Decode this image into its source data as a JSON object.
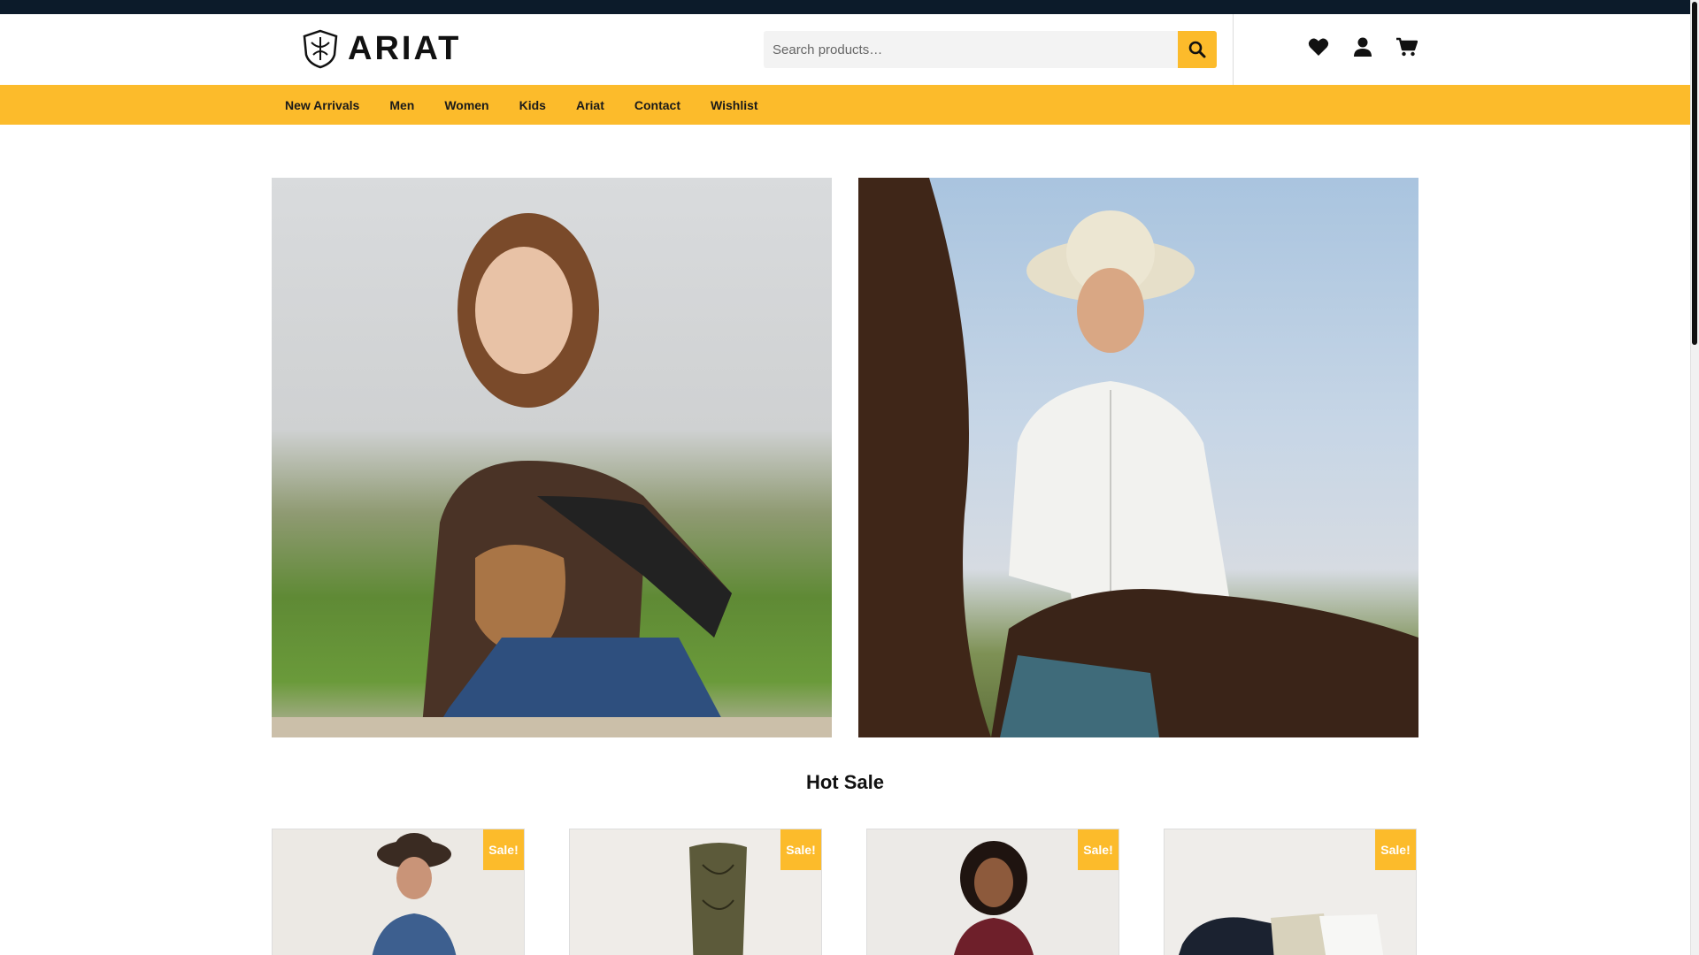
{
  "brand": {
    "name": "ARIAT"
  },
  "search": {
    "placeholder": "Search products…"
  },
  "header_icons": [
    "heart-icon",
    "user-icon",
    "cart-icon"
  ],
  "nav": {
    "items": [
      {
        "label": "New Arrivals"
      },
      {
        "label": "Men"
      },
      {
        "label": "Women"
      },
      {
        "label": "Kids"
      },
      {
        "label": "Ariat"
      },
      {
        "label": "Contact"
      },
      {
        "label": "Wishlist"
      }
    ]
  },
  "sections": {
    "hot_sale_title": "Hot Sale"
  },
  "products": [
    {
      "badge": "Sale!"
    },
    {
      "badge": "Sale!"
    },
    {
      "badge": "Sale!"
    },
    {
      "badge": "Sale!"
    }
  ],
  "colors": {
    "accent": "#fcbb2b",
    "topbar": "#0c1b2a",
    "search_bg": "#f3f3f3"
  }
}
